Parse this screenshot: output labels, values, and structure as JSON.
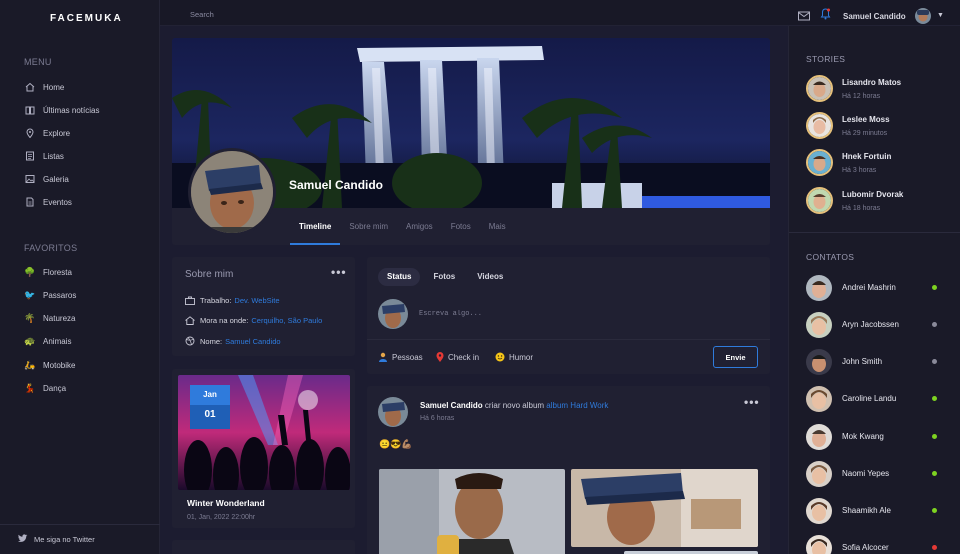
{
  "app": {
    "logo": "FACEMUKA"
  },
  "sidebar": {
    "menu_title": "MENU",
    "menu": [
      {
        "label": "Home",
        "icon": "home-icon"
      },
      {
        "label": "Últimas notícias",
        "icon": "book-icon"
      },
      {
        "label": "Explore",
        "icon": "location-icon"
      },
      {
        "label": "Listas",
        "icon": "list-icon"
      },
      {
        "label": "Galeria",
        "icon": "image-icon"
      },
      {
        "label": "Eventos",
        "icon": "document-icon"
      }
    ],
    "favorites_title": "FAVORITOS",
    "favorites": [
      {
        "label": "Floresta",
        "icon": "tree-emoji"
      },
      {
        "label": "Passaros",
        "icon": "bird-emoji"
      },
      {
        "label": "Natureza",
        "icon": "palm-emoji"
      },
      {
        "label": "Animais",
        "icon": "animal-emoji"
      },
      {
        "label": "Motobike",
        "icon": "motorbike-emoji"
      },
      {
        "label": "Dança",
        "icon": "dance-emoji"
      }
    ],
    "footer": "Me siga no Twitter"
  },
  "topbar": {
    "search_placeholder": "Search",
    "user_name": "Samuel Candido"
  },
  "profile": {
    "name": "Samuel Candido",
    "tabs": [
      "Timeline",
      "Sobre mim",
      "Amigos",
      "Fotos",
      "Mais"
    ],
    "active_tab": "Timeline"
  },
  "about": {
    "title": "Sobre mim",
    "work_label": "Trabalho:",
    "work_value": "Dev. WebSite",
    "lives_label": "Mora na onde:",
    "lives_value": "Cerquilho, São Paulo",
    "name_label": "Nome:",
    "name_value": "Samuel Candido"
  },
  "event": {
    "month": "Jan",
    "day": "01",
    "title": "Winter Wonderland",
    "date": "01, Jan, 2022 22:00hr"
  },
  "composer": {
    "tabs": [
      "Status",
      "Fotos",
      "Videos"
    ],
    "placeholder": "Escreva algo...",
    "actions": [
      "Pessoas",
      "Check in",
      "Humor"
    ],
    "send_label": "Envie"
  },
  "feed_post": {
    "user": "Samuel Candido",
    "action": "criar novo album",
    "album": "album Hard Work",
    "time": "Há 6 horas",
    "emojis": "😐😎💪🏽"
  },
  "stories": {
    "title": "STORIES",
    "items": [
      {
        "name": "Lisandro Matos",
        "time": "Há 12 horas"
      },
      {
        "name": "Leslee Moss",
        "time": "Há 29 minutos"
      },
      {
        "name": "Hnek Fortuin",
        "time": "Há 3 horas"
      },
      {
        "name": "Lubomir Dvorak",
        "time": "Há 18 horas"
      }
    ]
  },
  "contacts": {
    "title": "CONTATOS",
    "items": [
      {
        "name": "Andrei Mashrin",
        "status": "online"
      },
      {
        "name": "Aryn Jacobssen",
        "status": "away"
      },
      {
        "name": "John Smith",
        "status": "away"
      },
      {
        "name": "Caroline Landu",
        "status": "online"
      },
      {
        "name": "Mok Kwang",
        "status": "online"
      },
      {
        "name": "Naomi Yepes",
        "status": "online"
      },
      {
        "name": "Shaamikh Ale",
        "status": "online"
      },
      {
        "name": "Sofia Alcocer",
        "status": "busy"
      }
    ]
  },
  "colors": {
    "accent": "#2f7bdc",
    "online": "#7ed321",
    "away": "#8a8a9a",
    "busy": "#e53935",
    "story_ring": "#e5c07b"
  }
}
